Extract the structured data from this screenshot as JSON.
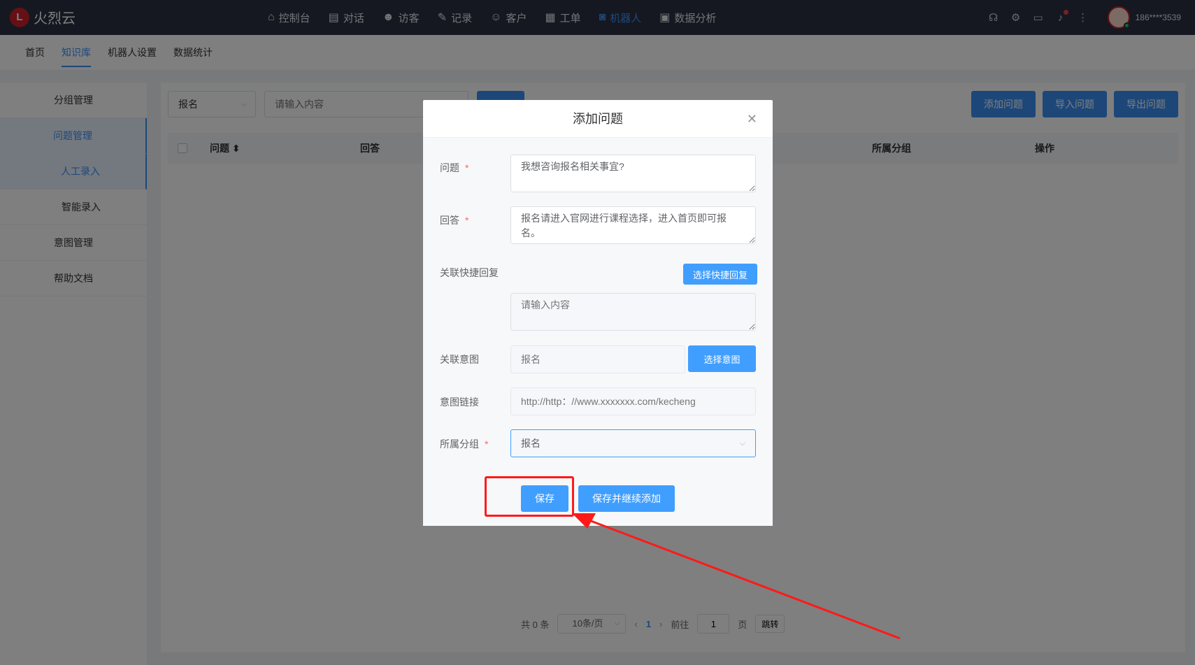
{
  "brand": {
    "logo_glyph": "L",
    "name": "火烈云",
    "color": "#c8202a"
  },
  "top_nav": [
    {
      "label": "控制台",
      "icon": "home-icon"
    },
    {
      "label": "对话",
      "icon": "chat-icon"
    },
    {
      "label": "访客",
      "icon": "visitor-icon"
    },
    {
      "label": "记录",
      "icon": "record-icon"
    },
    {
      "label": "客户",
      "icon": "customer-icon"
    },
    {
      "label": "工单",
      "icon": "ticket-icon"
    },
    {
      "label": "机器人",
      "icon": "robot-icon",
      "active": true
    },
    {
      "label": "数据分析",
      "icon": "chart-icon"
    }
  ],
  "top_right": {
    "username": "186****3539"
  },
  "sub_nav": [
    {
      "label": "首页"
    },
    {
      "label": "知识库",
      "active": true
    },
    {
      "label": "机器人设置"
    },
    {
      "label": "数据统计"
    }
  ],
  "sidebar": [
    {
      "label": "分组管理"
    },
    {
      "label": "问题管理",
      "active": true
    },
    {
      "label": "人工录入",
      "active": true,
      "sub": true
    },
    {
      "label": "智能录入",
      "sub": true
    },
    {
      "label": "意图管理"
    },
    {
      "label": "帮助文档"
    }
  ],
  "toolbar": {
    "group_select": "报名",
    "search_placeholder": "请输入内容",
    "add_button": "添加问题",
    "import_button": "导入问题",
    "export_button": "导出问题"
  },
  "table": {
    "columns": [
      "问题",
      "回答",
      "所属分组",
      "操作"
    ]
  },
  "pagination": {
    "total": "共 0 条",
    "page_size": "10条/页",
    "current_page": "1",
    "goto_label": "前往",
    "goto_value": "1",
    "page_unit": "页",
    "jump_button": "跳转"
  },
  "modal": {
    "title": "添加问题",
    "question_label": "问题",
    "question_value": "我想咨询报名相关事宜?",
    "answer_label": "回答",
    "answer_value": "报名请进入官网进行课程选择，进入首页即可报名。",
    "quick_reply_label": "关联快捷回复",
    "quick_reply_button": "选择快捷回复",
    "quick_reply_placeholder": "请输入内容",
    "intent_label": "关联意图",
    "intent_placeholder": "报名",
    "intent_button": "选择意图",
    "intent_link_label": "意图链接",
    "intent_link_placeholder": "http://http：//www.xxxxxxx.com/kecheng",
    "group_label": "所属分组",
    "group_value": "报名",
    "save_button": "保存",
    "save_continue_button": "保存并继续添加"
  },
  "colors": {
    "accent": "#409eff",
    "topbar": "#2a3142",
    "annotation": "#ff1a1a"
  }
}
